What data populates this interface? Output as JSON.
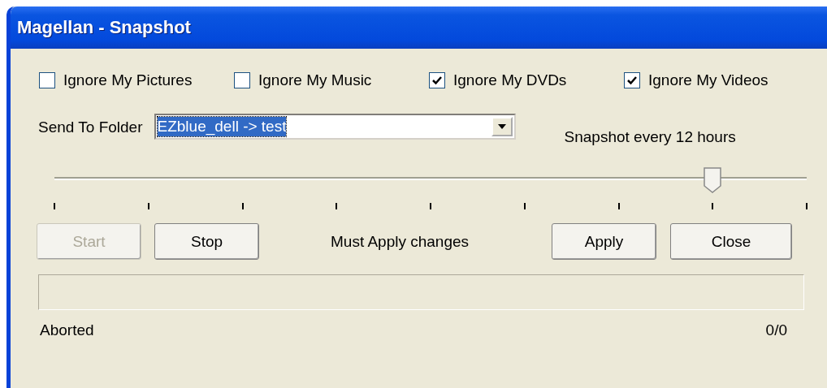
{
  "window": {
    "title": "Magellan - Snapshot"
  },
  "options": [
    {
      "label": "Ignore My Pictures",
      "checked": false
    },
    {
      "label": "Ignore My Music",
      "checked": false
    },
    {
      "label": "Ignore My DVDs",
      "checked": true
    },
    {
      "label": "Ignore My Videos",
      "checked": true
    }
  ],
  "folder": {
    "label": "Send To Folder",
    "value": "EZblue_dell -> test"
  },
  "interval": {
    "label": "Snapshot every 12 hours",
    "level": 0.875
  },
  "buttons": [
    {
      "label": "Start",
      "disabled": true
    },
    {
      "label": "Stop",
      "disabled": false
    }
  ],
  "message": "Must Apply changes",
  "actions": [
    {
      "label": "Apply"
    },
    {
      "label": "Close"
    }
  ],
  "progress": {
    "level": 0
  },
  "status": {
    "text": "Aborted",
    "count": "0/0"
  }
}
